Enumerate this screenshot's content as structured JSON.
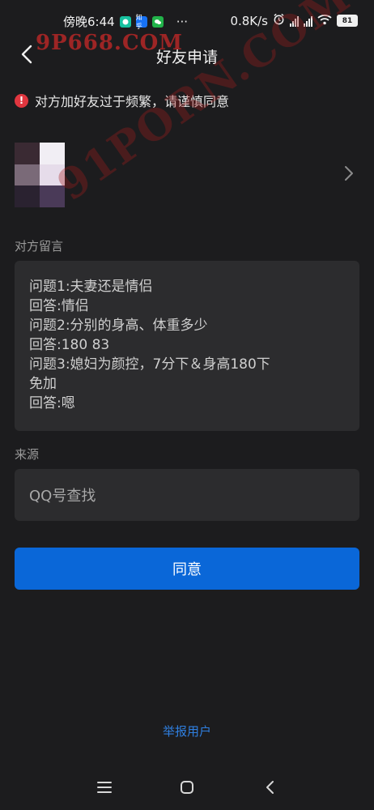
{
  "status_bar": {
    "time": "傍晚6:44",
    "net_speed": "0.8K/s",
    "battery": "81",
    "app_badges": [
      {
        "name": "qq-app-icon",
        "color": "#17c1a0"
      },
      {
        "name": "zhihu-app-icon",
        "color": "#1772f6",
        "text": "知乎"
      },
      {
        "name": "wechat-app-icon",
        "color": "#22b34a"
      }
    ],
    "more": "···"
  },
  "watermark": {
    "top": "9P668.COM",
    "diagonal": "91PORN.COM"
  },
  "nav": {
    "title": "好友申请"
  },
  "warning": {
    "text": "对方加好友过于频繁，请谨慎同意"
  },
  "message": {
    "label": "对方留言",
    "lines": [
      "问题1:夫妻还是情侣",
      "回答:情侣",
      "问题2:分别的身高、体重多少",
      "回答:180 83",
      "问题3:媳妇为颜控，7分下＆身高180下",
      "免加",
      "回答:嗯"
    ]
  },
  "source": {
    "label": "来源",
    "value": "QQ号查找"
  },
  "actions": {
    "agree": "同意",
    "report": "举报用户"
  },
  "colors": {
    "background": "#1c1c1e",
    "card": "#2c2c2e",
    "accent": "#0a67d8",
    "link": "#2f7fe0",
    "warning": "#e0363f"
  }
}
